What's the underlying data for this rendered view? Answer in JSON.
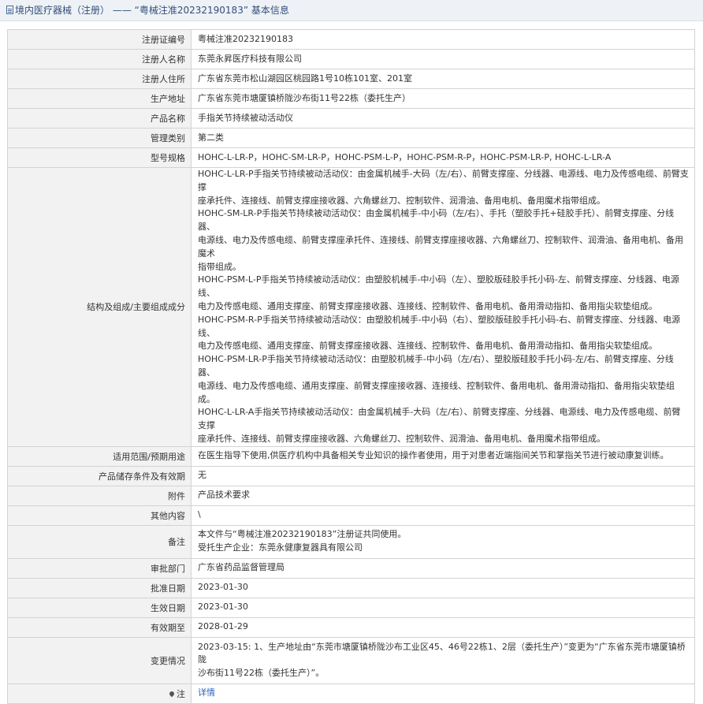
{
  "header": {
    "title": "境内医疗器械（注册） —— “粤械注准20232190183” 基本信息"
  },
  "rows": {
    "reg_no": {
      "label": "注册证编号",
      "value": "粤械注准20232190183"
    },
    "registrant": {
      "label": "注册人名称",
      "value": "东莞永昇医疗科技有限公司"
    },
    "address": {
      "label": "注册人住所",
      "value": "广东省东莞市松山湖园区桃园路1号10栋101室、201室"
    },
    "production_address": {
      "label": "生产地址",
      "value": "广东省东莞市塘厦镇桥陇沙布街11号22栋（委托生产）"
    },
    "product_name": {
      "label": "产品名称",
      "value": "手指关节持续被动活动仪"
    },
    "mgmt_class": {
      "label": "管理类别",
      "value": "第二类"
    },
    "model": {
      "label": "型号规格",
      "value": "HOHC-L-LR-P，HOHC-SM-LR-P，HOHC-PSM-L-P，HOHC-PSM-R-P，HOHC-PSM-LR-P, HOHC-L-LR-A"
    },
    "structure": {
      "label": "结构及组成/主要组成成分",
      "lines": [
        "HOHC-L-LR-P手指关节持续被动活动仪：由金属机械手-大码（左/右）、前臂支撑座、分线器、电源线、电力及传感电缆、前臂支撑",
        "座承托件、连接线、前臂支撑座接收器、六角螺丝刀、控制软件、润滑油、备用电机、备用魔术指带组成。",
        "HOHC-SM-LR-P手指关节持续被动活动仪：由金属机械手-中小码（左/右）、手托（塑胶手托+硅胶手托）、前臂支撑座、分线器、",
        "电源线、电力及传感电缆、前臂支撑座承托件、连接线、前臂支撑座接收器、六角螺丝刀、控制软件、润滑油、备用电机、备用魔术",
        "指带组成。",
        "HOHC-PSM-L-P手指关节持续被动活动仪：由塑胶机械手-中小码（左）、塑胶版硅胶手托小码-左、前臂支撑座、分线器、电源线、",
        "电力及传感电缆、通用支撑座、前臂支撑座接收器、连接线、控制软件、备用电机、备用滑动指扣、备用指尖软垫组成。",
        "HOHC-PSM-R-P手指关节持续被动活动仪：由塑胶机械手-中小码（右）、塑胶版硅胶手托小码-右、前臂支撑座、分线器、电源线、",
        "电力及传感电缆、通用支撑座、前臂支撑座接收器、连接线、控制软件、备用电机、备用滑动指扣、备用指尖软垫组成。",
        "HOHC-PSM-LR-P手指关节持续被动活动仪：由塑胶机械手-中小码（左/右）、塑胶版硅胶手托小码-左/右、前臂支撑座、分线器、",
        "电源线、电力及传感电缆、通用支撑座、前臂支撑座接收器、连接线、控制软件、备用电机、备用滑动指扣、备用指尖软垫组成。",
        "HOHC-L-LR-A手指关节持续被动活动仪：由金属机械手-大码（左/右）、前臂支撑座、分线器、电源线、电力及传感电缆、前臂支撑",
        "座承托件、连接线、前臂支撑座接收器、六角螺丝刀、控制软件、润滑油、备用电机、备用魔术指带组成。"
      ]
    },
    "scope": {
      "label": "适用范围/预期用途",
      "value": "在医生指导下使用,供医疗机构中具备相关专业知识的操作者使用，用于对患者近端指间关节和掌指关节进行被动康复训练。"
    },
    "storage": {
      "label": "产品储存条件及有效期",
      "value": "无"
    },
    "attachment": {
      "label": "附件",
      "value": "产品技术要求"
    },
    "other": {
      "label": "其他内容",
      "value": "\\"
    },
    "remarks": {
      "label": "备注",
      "lines": [
        "本文件与“粤械注准20232190183”注册证共同使用。",
        "受托生产企业：东莞永健康复器具有限公司"
      ]
    },
    "approval_dept": {
      "label": "审批部门",
      "value": "广东省药品监督管理局"
    },
    "approval_date": {
      "label": "批准日期",
      "value": "2023-01-30"
    },
    "effective_date": {
      "label": "生效日期",
      "value": "2023-01-30"
    },
    "expiry_date": {
      "label": "有效期至",
      "value": "2028-01-29"
    },
    "changes": {
      "label": "变更情况",
      "lines": [
        "2023-03-15: 1、生产地址由“东莞市塘厦镇桥陇沙布工业区45、46号22栋1、2层（委托生产）”变更为“广东省东莞市塘厦镇桥陇",
        "沙布街11号22栋（委托生产）”。"
      ]
    },
    "note": {
      "label": "注",
      "link_text": "详情"
    }
  },
  "colors": {
    "header_bg": "#eef2f6",
    "label_bg": "#f2f2f2",
    "border": "#d3d3d3",
    "link": "#2b62b8"
  }
}
